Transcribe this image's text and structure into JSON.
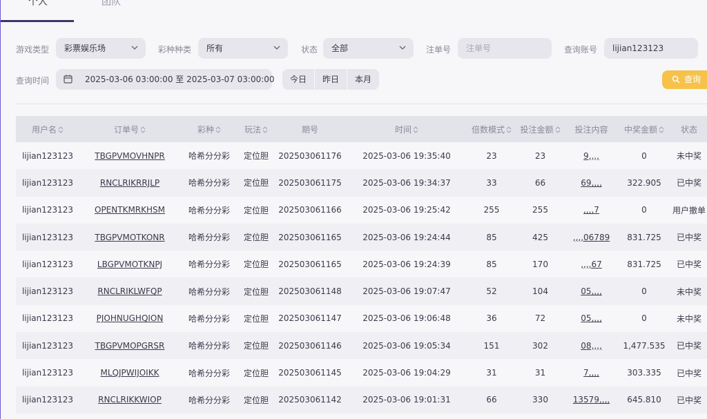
{
  "tabs": [
    {
      "label": "个人"
    },
    {
      "label": "团队"
    }
  ],
  "filters": {
    "game_type": {
      "label": "游戏类型",
      "value": "彩票娱乐场"
    },
    "lottery_type": {
      "label": "彩种种类",
      "value": "所有"
    },
    "status": {
      "label": "状态",
      "value": "全部"
    },
    "order_no": {
      "label": "注单号",
      "placeholder": "注单号"
    },
    "account": {
      "label": "查询账号",
      "value": "lijian123123"
    },
    "time": {
      "label": "查询时间",
      "value": "2025-03-06 03:00:00 至 2025-03-07 03:00:00"
    },
    "quick": {
      "today": "今日",
      "yesterday": "昨日",
      "month": "本月"
    },
    "search_button": "查询"
  },
  "table": {
    "headers": [
      "用户名",
      "订单号",
      "彩种",
      "玩法",
      "期号",
      "时间",
      "倍数模式",
      "投注金额",
      "投注内容",
      "中奖金额",
      "状态"
    ],
    "rows": [
      {
        "user": "lijian123123",
        "order": "TBGPVMOVHNPR",
        "lottery": "哈希分分彩",
        "play": "定位胆",
        "issue": "202503061176",
        "time": "2025-03-06 19:35:40",
        "multiple": "23",
        "amount": "23",
        "content": "9,,,,",
        "win": "0",
        "status": "未中奖"
      },
      {
        "user": "lijian123123",
        "order": "RNCLRIKRRJLP",
        "lottery": "哈希分分彩",
        "play": "定位胆",
        "issue": "202503061175",
        "time": "2025-03-06 19:34:37",
        "multiple": "33",
        "amount": "66",
        "content": "69,,,,",
        "win": "322.905",
        "status": "已中奖"
      },
      {
        "user": "lijian123123",
        "order": "OPENTKMRKHSM",
        "lottery": "哈希分分彩",
        "play": "定位胆",
        "issue": "202503061166",
        "time": "2025-03-06 19:25:42",
        "multiple": "255",
        "amount": "255",
        "content": ",,,,7",
        "win": "0",
        "status": "用户撤单"
      },
      {
        "user": "lijian123123",
        "order": "TBGPVMOTKONR",
        "lottery": "哈希分分彩",
        "play": "定位胆",
        "issue": "202503061165",
        "time": "2025-03-06 19:24:44",
        "multiple": "85",
        "amount": "425",
        "content": ",,,,06789",
        "win": "831.725",
        "status": "已中奖"
      },
      {
        "user": "lijian123123",
        "order": "LBGPVMOTKNPJ",
        "lottery": "哈希分分彩",
        "play": "定位胆",
        "issue": "202503061165",
        "time": "2025-03-06 19:24:39",
        "multiple": "85",
        "amount": "170",
        "content": ",,,,67",
        "win": "831.725",
        "status": "已中奖"
      },
      {
        "user": "lijian123123",
        "order": "RNCLRIKLWFQP",
        "lottery": "哈希分分彩",
        "play": "定位胆",
        "issue": "202503061148",
        "time": "2025-03-06 19:07:47",
        "multiple": "52",
        "amount": "104",
        "content": "05,,,,",
        "win": "0",
        "status": "未中奖"
      },
      {
        "user": "lijian123123",
        "order": "PJOHNUGHQION",
        "lottery": "哈希分分彩",
        "play": "定位胆",
        "issue": "202503061147",
        "time": "2025-03-06 19:06:48",
        "multiple": "36",
        "amount": "72",
        "content": "05,,,,",
        "win": "0",
        "status": "未中奖"
      },
      {
        "user": "lijian123123",
        "order": "TBGPVMOPGRSR",
        "lottery": "哈希分分彩",
        "play": "定位胆",
        "issue": "202503061146",
        "time": "2025-03-06 19:05:34",
        "multiple": "151",
        "amount": "302",
        "content": "08,,,,",
        "win": "1,477.535",
        "status": "已中奖"
      },
      {
        "user": "lijian123123",
        "order": "MLQJPWIJOIKK",
        "lottery": "哈希分分彩",
        "play": "定位胆",
        "issue": "202503061145",
        "time": "2025-03-06 19:04:29",
        "multiple": "31",
        "amount": "31",
        "content": "7,,,,",
        "win": "303.335",
        "status": "已中奖"
      },
      {
        "user": "lijian123123",
        "order": "RNCLRIKKWIOP",
        "lottery": "哈希分分彩",
        "play": "定位胆",
        "issue": "202503061142",
        "time": "2025-03-06 19:01:31",
        "multiple": "66",
        "amount": "330",
        "content": "13579,,,,",
        "win": "645.810",
        "status": "已中奖"
      }
    ]
  },
  "colors": {
    "accent": "#3b3668",
    "search_button": "#f6c24a"
  }
}
